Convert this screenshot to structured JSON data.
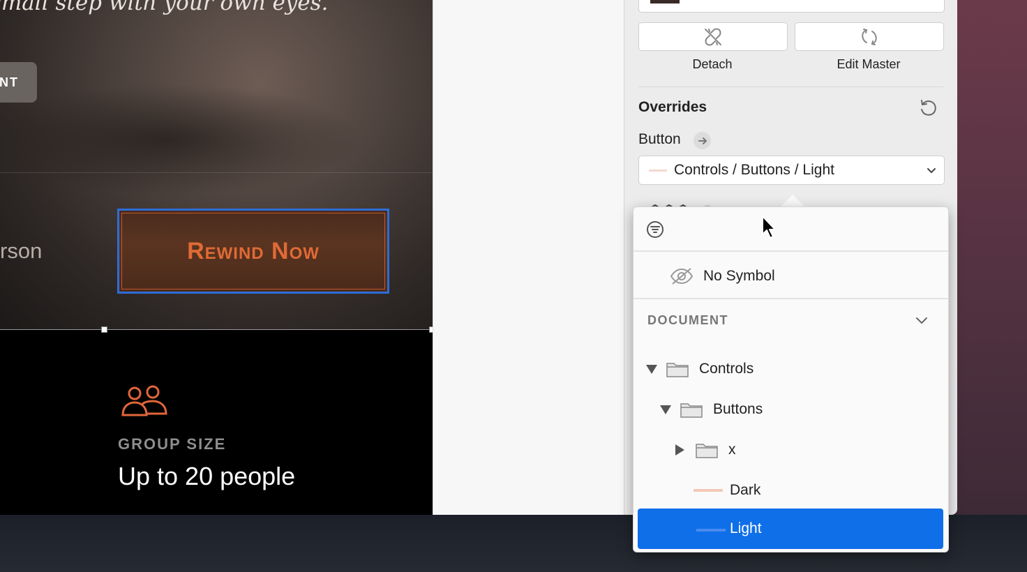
{
  "canvas": {
    "hero_tagline": "small step with your own eyes.",
    "hero_pill_text": "NT",
    "hero_name_partial": "rson",
    "cta_label": "Rewind Now",
    "group_label": "GROUP SIZE",
    "group_value": "Up to 20 people"
  },
  "inspector": {
    "detach_label": "Detach",
    "edit_master_label": "Edit Master",
    "overrides_title": "Overrides",
    "button_label": "Button",
    "selected_symbol": "Controls / Buttons / Light"
  },
  "popover": {
    "no_symbol_label": "No Symbol",
    "document_header": "DOCUMENT",
    "tree": [
      {
        "label": "Controls",
        "expanded": true
      },
      {
        "label": "Buttons",
        "expanded": true
      },
      {
        "label": "x",
        "expanded": false
      },
      {
        "label": "Dark"
      },
      {
        "label": "Light",
        "selected": true
      }
    ]
  },
  "colors": {
    "accent_blue": "#0f6fe8",
    "cta_orange": "#e06a35",
    "selection_border": "#2d6dd8"
  }
}
